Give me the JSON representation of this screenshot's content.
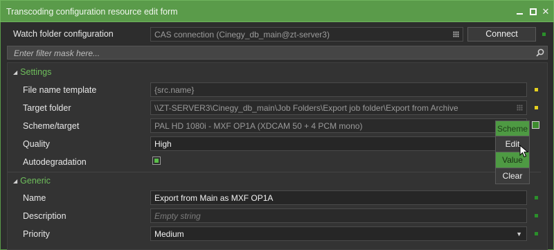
{
  "window": {
    "title": "Transcoding configuration resource edit form"
  },
  "header": {
    "watch_label": "Watch folder configuration",
    "watch_value": "CAS connection (Cinegy_db_main@zt-server3)",
    "connect_label": "Connect"
  },
  "filter": {
    "placeholder": "Enter filter mask here..."
  },
  "settings": {
    "section_label": "Settings",
    "file_name_template": {
      "label": "File name template",
      "value": "{src.name}"
    },
    "target_folder": {
      "label": "Target folder",
      "value": "\\\\ZT-SERVER3\\Cinegy_db_main\\Job Folders\\Export job folder\\Export from Archive"
    },
    "scheme_target": {
      "label": "Scheme/target",
      "value": "PAL HD 1080i - MXF OP1A (XDCAM 50 + 4 PCM mono)"
    },
    "quality": {
      "label": "Quality",
      "value": "High"
    },
    "autodegradation": {
      "label": "Autodegradation",
      "checked": true
    }
  },
  "generic": {
    "section_label": "Generic",
    "name": {
      "label": "Name",
      "value": "Export from Main as MXF OP1A"
    },
    "description": {
      "label": "Description",
      "placeholder": "Empty string"
    },
    "priority": {
      "label": "Priority",
      "value": "Medium"
    }
  },
  "context_menu": {
    "items": [
      "Scheme",
      "Edit",
      "Value",
      "Clear"
    ]
  },
  "colors": {
    "accent_green": "#5a9b4a",
    "indicator_yellow": "#e6d11f",
    "indicator_green": "#2a8f2a",
    "section_green": "#6fbf5c"
  }
}
